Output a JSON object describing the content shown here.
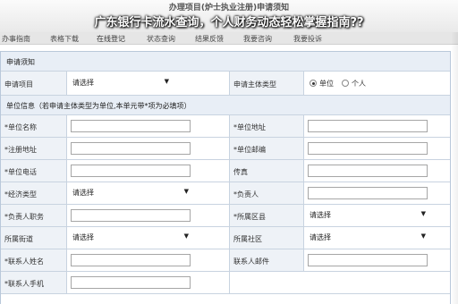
{
  "header": {
    "notice_title": "办理项目(炉士执业注册)申请须知",
    "overlay_title": "广东银行卡流水查询，个人财务动态轻松掌握指南??"
  },
  "tabs": [
    {
      "label": "办事指南"
    },
    {
      "label": "表格下载"
    },
    {
      "label": "在线登记"
    },
    {
      "label": "状态查询"
    },
    {
      "label": "结果反馈"
    },
    {
      "label": "我要咨询"
    },
    {
      "label": "我要投诉"
    }
  ],
  "form": {
    "section1_title": "申请须知",
    "project_label": "申请项目",
    "project_select": "请选择",
    "subject_type_label": "申请主体类型",
    "radio_unit": "单位",
    "radio_person": "个人",
    "section2_title": "单位信息（若申请主体类型为单位,本单元带*项为必填项）",
    "fields": {
      "unit_name": "*单位名称",
      "unit_address": "*单位地址",
      "reg_address": "*注册地址",
      "unit_postcode": "*单位邮编",
      "unit_phone": "*单位电话",
      "fax": "传真",
      "econ_type": "*经济类型",
      "econ_select": "请选择",
      "legal_person": "*负责人",
      "legal_duty": "*负责人职务",
      "district": "*所属区县",
      "district_select": "请选择",
      "street": "所属街道",
      "street_select": "请选择",
      "community": "所属社区",
      "community_select": "请选择",
      "contact_name": "*联系人姓名",
      "contact_email": "联系人邮件",
      "contact_mobile": "*联系人手机"
    }
  }
}
